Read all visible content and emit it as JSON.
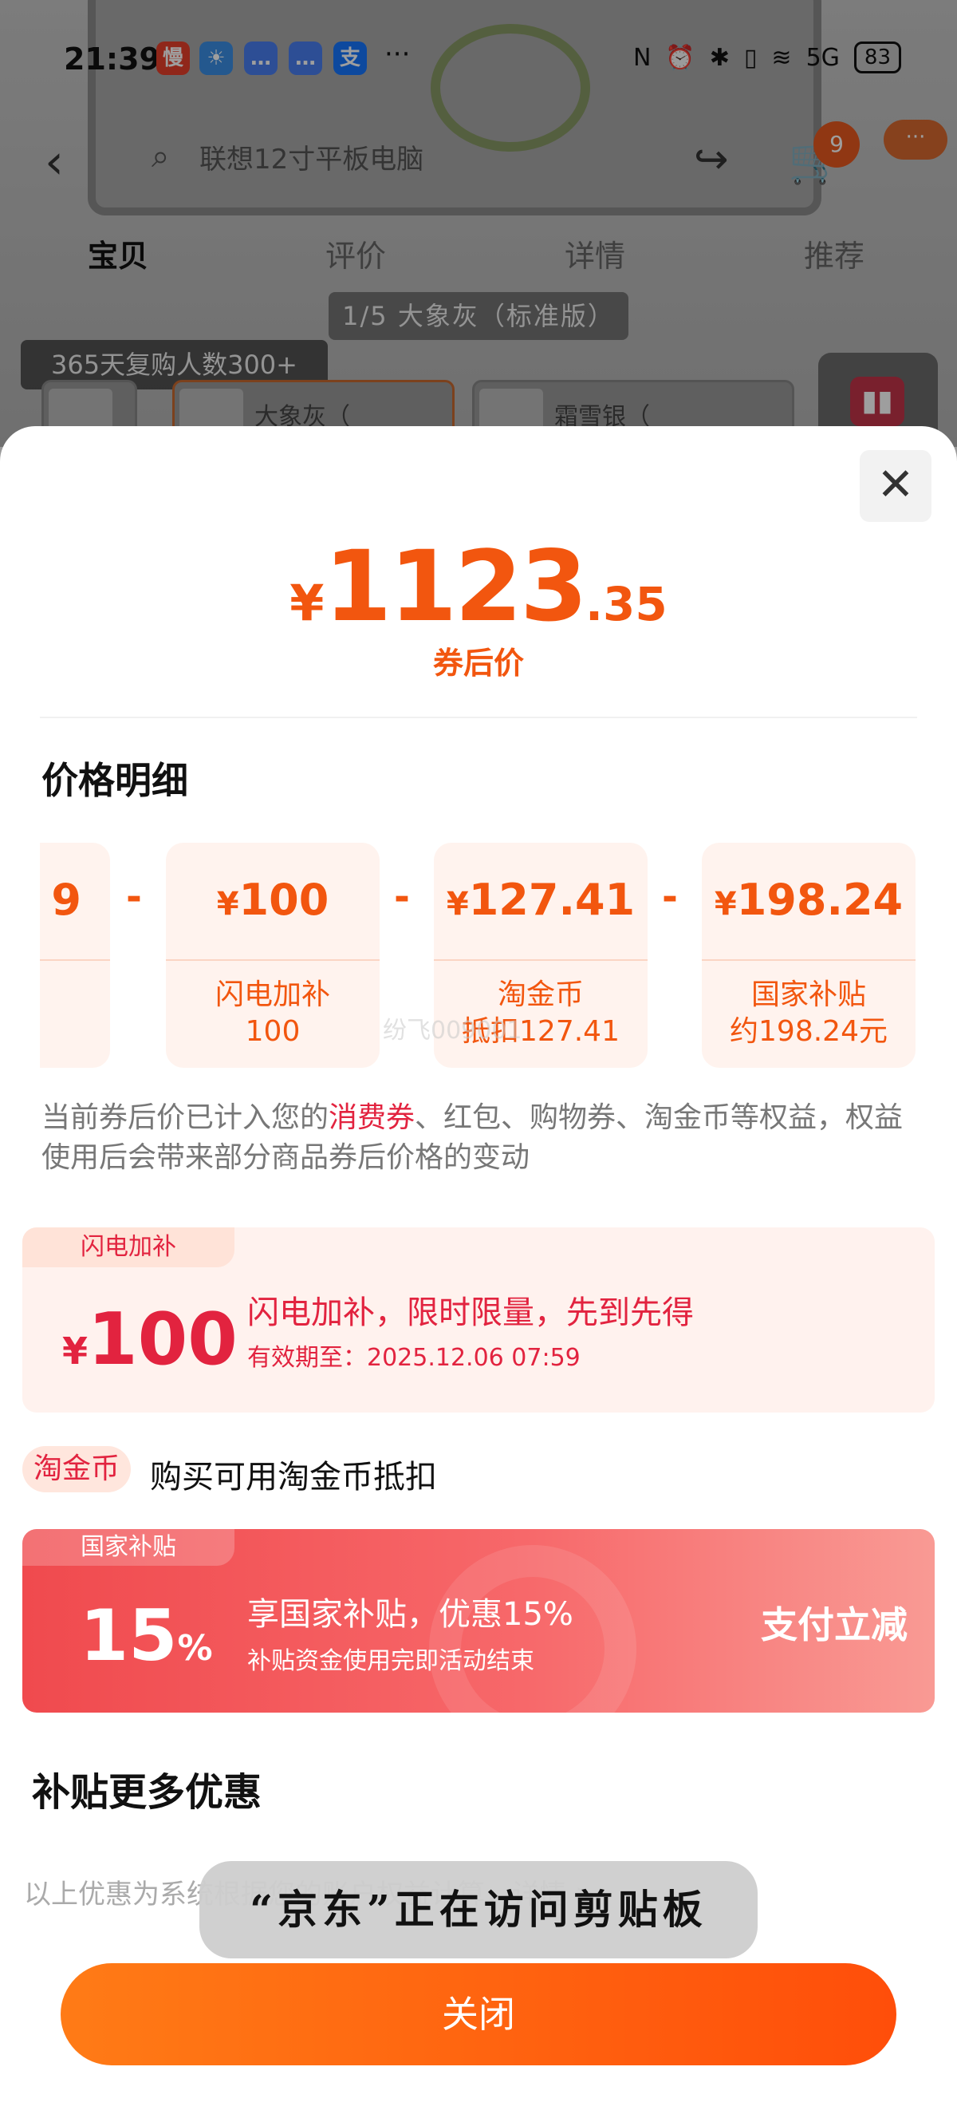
{
  "status_bar": {
    "time": "21:39",
    "app_icons": [
      {
        "name": "slow-app-icon",
        "glyph": "慢",
        "color": "#e8402a"
      },
      {
        "name": "weather-icon",
        "glyph": "☀",
        "color": "#3a8ee6"
      },
      {
        "name": "message-icon",
        "glyph": "…",
        "color": "#4a7ff0"
      },
      {
        "name": "message-icon-2",
        "glyph": "…",
        "color": "#4a7ff0"
      },
      {
        "name": "alipay-icon",
        "glyph": "支",
        "color": "#1677ff"
      }
    ],
    "more": "···",
    "signal": "5G",
    "battery": "83"
  },
  "nav": {
    "back": "‹",
    "search_placeholder": "联想12寸平板电脑",
    "share": "↪",
    "cart": "🛒",
    "cart_badge": "9",
    "more": "···"
  },
  "tabs": [
    "宝贝",
    "评价",
    "详情",
    "推荐"
  ],
  "variant_pill": "1/5 大象灰（标准版）",
  "repurchase_badge": "365天复购人数300+",
  "thumbnails": [
    "大象灰（",
    "霜雪银（"
  ],
  "sheet": {
    "close_icon": "✕",
    "price": {
      "yen": "¥",
      "integer": "1123",
      "decimal": ".35",
      "label": "券后价"
    },
    "breakdown_title": "价格明细",
    "breakdown": [
      {
        "value": "9",
        "label_line1": "",
        "label_line2": "",
        "partial": true
      },
      {
        "value_yen": "¥",
        "value": "100",
        "label_line1": "闪电加补",
        "label_line2": "100"
      },
      {
        "value_yen": "¥",
        "value": "127.41",
        "label_line1": "淘金币",
        "label_line2": "抵扣127.41"
      },
      {
        "value_yen": "¥",
        "value": "198.24",
        "label_line1": "国家补贴",
        "label_line2": "约198.24元"
      }
    ],
    "minus": "-",
    "watermark": "纷飞009001",
    "notice_pre": "当前券后价已计入您的",
    "notice_highlight": "消费券",
    "notice_post": "、红包、购物券、淘金币等权益，权益使用后会带来部分商品券后价格的变动",
    "flash": {
      "tag": "闪电加补",
      "yen": "¥",
      "amount": "100",
      "title": "闪电加补，限时限量，先到先得",
      "expiry": "有效期至：2025.12.06 07:59"
    },
    "coin": {
      "tag": "淘金币",
      "text": "购买可用淘金币抵扣"
    },
    "subsidy": {
      "tag": "国家补贴",
      "percent": "15",
      "percent_sign": "%",
      "title": "享国家补贴，优惠15%",
      "subtitle": "补贴资金使用完即活动结束",
      "action": "支付立减"
    },
    "more_title": "补贴更多优惠",
    "disclaimer": "以上优惠为系统根据您的账户权益计算，详情 >",
    "toast": "“京东”正在访问剪贴板",
    "close_button": "关闭"
  },
  "colors": {
    "accent": "#f2560f",
    "red": "#e2233f",
    "button": "#ff5a0c"
  }
}
